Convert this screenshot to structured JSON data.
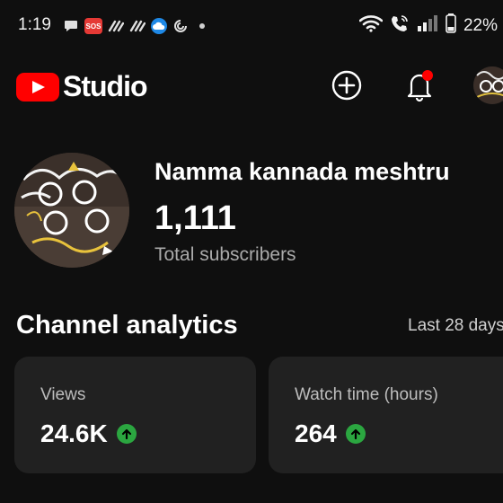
{
  "status_bar": {
    "time": "1:19",
    "sos_label": "SOS",
    "battery_percent": "22%"
  },
  "header": {
    "logo_text": "Studio",
    "brand_color": "#ff0000",
    "notification_dot_color": "#ff0000"
  },
  "channel": {
    "name": "Namma kannada meshtru",
    "subscriber_count": "1,111",
    "subscriber_label": "Total subscribers"
  },
  "analytics": {
    "title": "Channel analytics",
    "period": "Last 28 days",
    "cards": [
      {
        "label": "Views",
        "value": "24.6K",
        "trend": "up"
      },
      {
        "label": "Watch time (hours)",
        "value": "264",
        "trend": "up"
      }
    ],
    "trend_color": "#2ba640"
  }
}
